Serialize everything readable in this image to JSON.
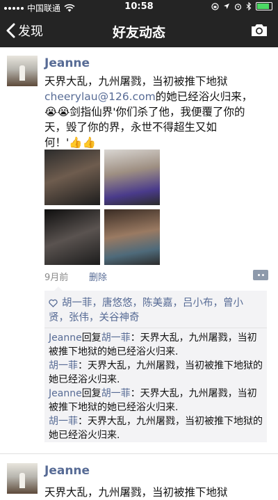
{
  "status_bar": {
    "carrier": "中国联通",
    "time": "10:58"
  },
  "nav": {
    "back_label": "发现",
    "title": "好友动态"
  },
  "colors": {
    "bar_bg": "#242424",
    "link": "#576b95",
    "comment_bg": "#f3f3f5"
  },
  "posts": [
    {
      "author": "Jeanne",
      "text_part1": "天界大乱，九州屠戮，当初被推下地狱",
      "email": "cheerylau@126.com",
      "text_part2": "的她已经浴火归来，",
      "text_part3": "😭😭剑指仙界'你们杀了他，我便覆了你的天，毁了你的界，永世不得超生又如何！'👍👍",
      "time": "9月前",
      "delete_label": "删除",
      "likes": [
        "胡一菲",
        "唐悠悠",
        "陈美嘉",
        "吕小布",
        "曾小贤",
        "张伟",
        "关谷神奇"
      ],
      "comments": [
        {
          "from": "Jeanne",
          "reply_word": "回复",
          "to": "胡一菲",
          "text": "：天界大乱，九州屠戮，当初被推下地狱的她已经浴火归来."
        },
        {
          "from": "胡一菲",
          "reply_word": "",
          "to": "",
          "text": "：天界大乱，九州屠戮，当初被推下地狱的她已经浴火归来."
        },
        {
          "from": "Jeanne",
          "reply_word": "回复",
          "to": "胡一菲",
          "text": "：天界大乱，九州屠戮，当初被推下地狱的她已经浴火归来."
        },
        {
          "from": "胡一菲",
          "reply_word": "",
          "to": "",
          "text": "：天界大乱，九州屠戮，当初被推下地狱的她已经浴火归来."
        }
      ]
    },
    {
      "author": "Jeanne",
      "text_part1": "天界大乱，九州屠戮，当初被推下地狱"
    }
  ]
}
